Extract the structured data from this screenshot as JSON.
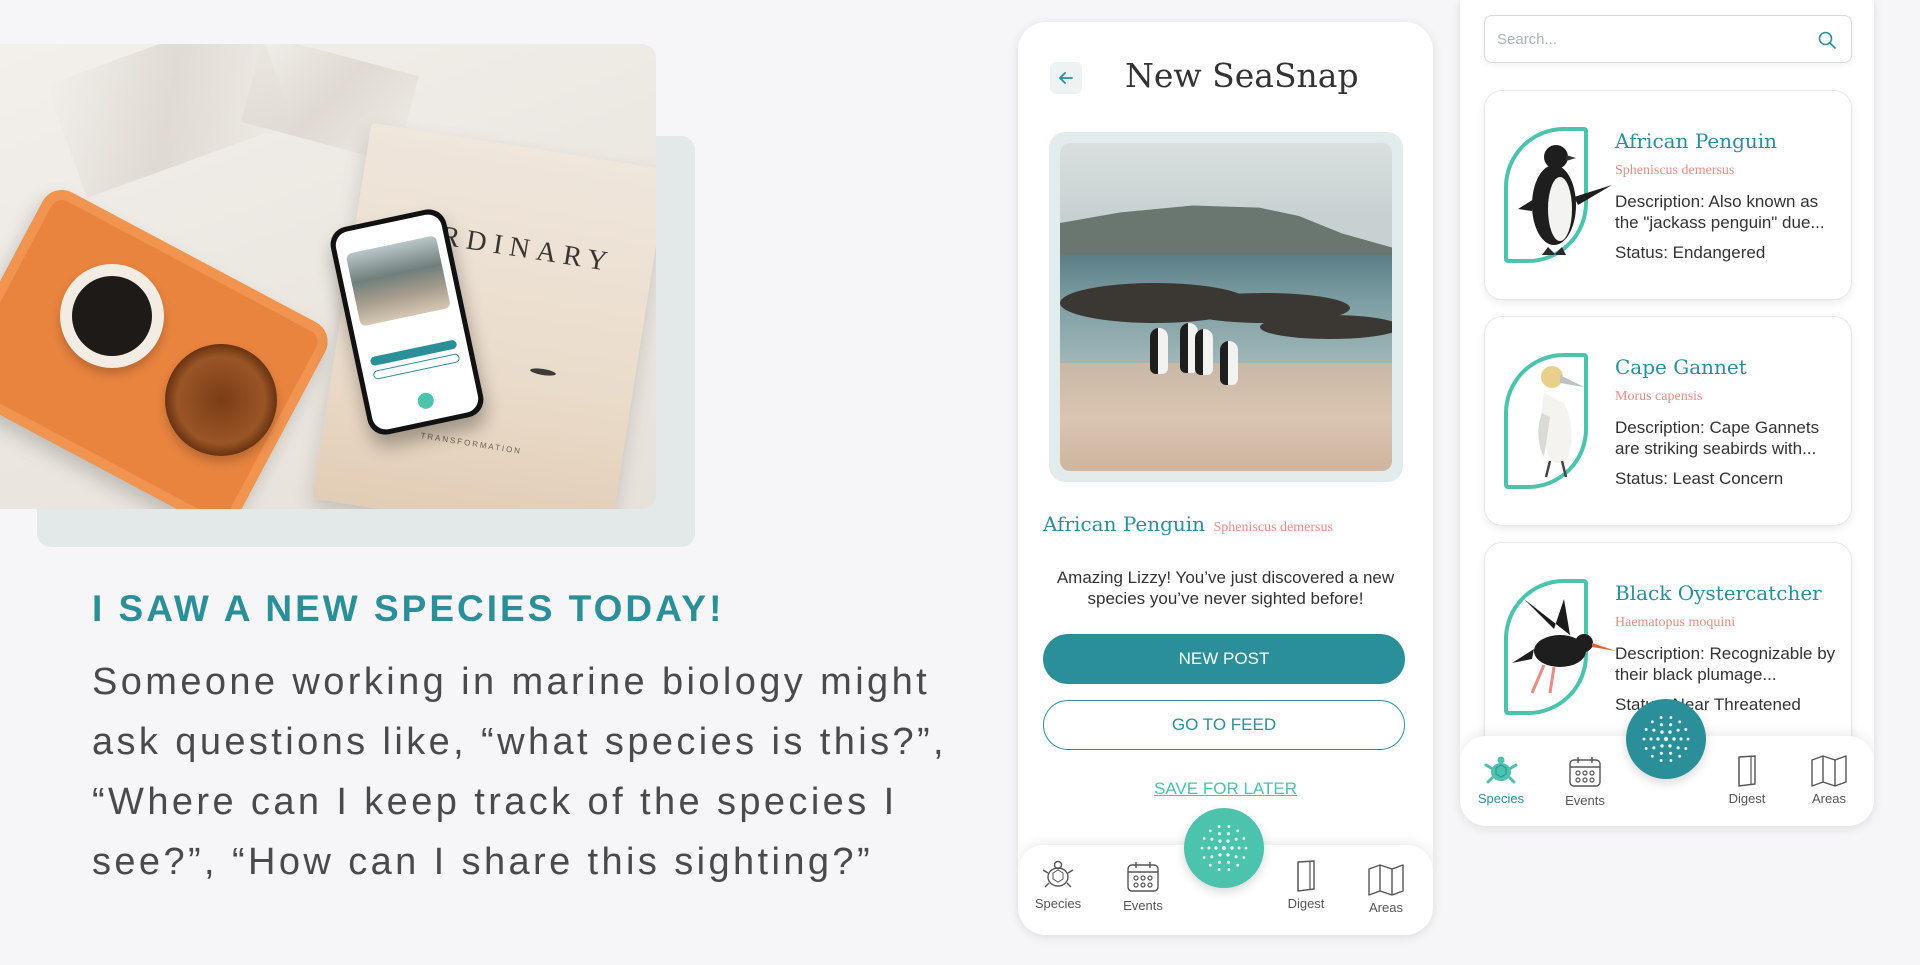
{
  "left": {
    "photo": {
      "book_title": "RDINARY",
      "book_subtitle": "TRANSFORMATION"
    },
    "headline": "I SAW A NEW SPECIES TODAY!",
    "body": "Someone working in marine biology might ask questions like, “what species is this?”, “Where can I keep track of the species I see?”, “How can I share this sighting?”"
  },
  "phone1": {
    "title": "New SeaSnap",
    "back_icon": "arrow-left-icon",
    "species_name": "African Penguin",
    "species_scientific": "Spheniscus demersus",
    "message": "Amazing Lizzy! You’ve just discovered a new species you’ve never sighted before!",
    "new_post_label": "NEW POST",
    "go_to_feed_label": "GO TO FEED",
    "save_later_label": "SAVE FOR LATER",
    "nav": [
      {
        "label": "Species",
        "icon": "turtle-icon"
      },
      {
        "label": "Events",
        "icon": "calendar-icon"
      },
      {
        "label": "Digest",
        "icon": "book-icon"
      },
      {
        "label": "Areas",
        "icon": "map-icon"
      }
    ]
  },
  "phone2": {
    "search_placeholder": "Search...",
    "cards": [
      {
        "name": "African Penguin",
        "scientific": "Spheniscus demersus",
        "description": "Description: Also known as the \"jackass penguin\" due...",
        "status": "Status: Endangered"
      },
      {
        "name": "Cape Gannet",
        "scientific": "Morus capensis",
        "description": "Description: Cape Gannets are striking seabirds with...",
        "status": "Status: Least Concern"
      },
      {
        "name": "Black Oystercatcher",
        "scientific": "Haematopus moquini",
        "description": "Description: Recognizable by their black plumage...",
        "status": "Status: Near Threatened"
      }
    ],
    "nav": [
      {
        "label": "Species",
        "icon": "turtle-icon",
        "active": true
      },
      {
        "label": "Events",
        "icon": "calendar-icon"
      },
      {
        "label": "Digest",
        "icon": "book-icon"
      },
      {
        "label": "Areas",
        "icon": "map-icon"
      }
    ]
  },
  "colors": {
    "teal": "#2b8f9a",
    "mint": "#4bc3ad",
    "coral": "#e98c86",
    "background": "#f6f5f8"
  }
}
